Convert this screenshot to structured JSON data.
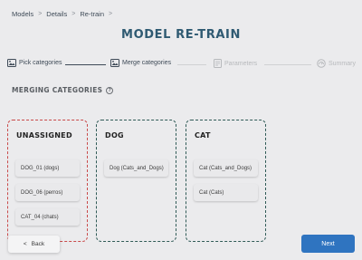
{
  "breadcrumb": {
    "items": [
      "Models",
      "Details",
      "Re-train"
    ],
    "separator": ">"
  },
  "page_title": "MODEL RE-TRAIN",
  "stepper": {
    "steps": [
      {
        "label": "Pick categories",
        "state": "done",
        "icon": "image-icon"
      },
      {
        "label": "Merge categories",
        "state": "active",
        "icon": "image-icon"
      },
      {
        "label": "Parameters",
        "state": "inactive",
        "icon": "settings-doc-icon"
      },
      {
        "label": "Summary",
        "state": "inactive",
        "icon": "dashboard-icon"
      }
    ]
  },
  "section": {
    "title": "MERGING CATEGORIES",
    "help_icon": "?"
  },
  "columns": [
    {
      "title": "UNASSIGNED",
      "border_color": "#c94a4a",
      "cards": [
        "DOG_01 (dogs)",
        "DOG_06 (perros)",
        "CAT_04 (chats)"
      ]
    },
    {
      "title": "DOG",
      "border_color": "#2f5a56",
      "cards": [
        "Dog (Cats_and_Dogs)"
      ]
    },
    {
      "title": "CAT",
      "border_color": "#2f5a56",
      "cards": [
        "Cat (Cats_and_Dogs)",
        "Cat (Cats)"
      ]
    }
  ],
  "buttons": {
    "back_label": "Back",
    "back_icon": "<",
    "next_label": "Next"
  },
  "colors": {
    "background": "#ebebed",
    "title": "#2f5a72",
    "primary": "#2f74c0",
    "unassigned_border": "#c94a4a",
    "category_border": "#2f5a56"
  }
}
